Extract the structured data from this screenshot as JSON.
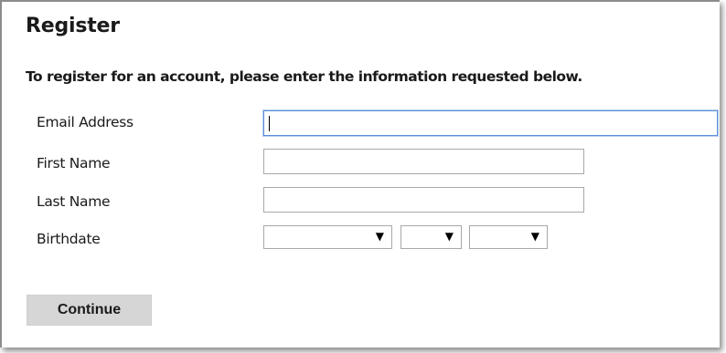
{
  "page": {
    "title": "Register",
    "intro": "To register for an account, please enter the information requested below."
  },
  "form": {
    "email": {
      "label": "Email Address",
      "value": ""
    },
    "first_name": {
      "label": "First Name",
      "value": ""
    },
    "last_name": {
      "label": "Last Name",
      "value": ""
    },
    "birthdate": {
      "label": "Birthdate",
      "month": {
        "selected": "",
        "arrow": "▼"
      },
      "day": {
        "selected": "",
        "arrow": "▼"
      },
      "year": {
        "selected": "",
        "arrow": "▼"
      }
    },
    "continue_label": "Continue"
  },
  "colors": {
    "focus_border": "#5b8dd6",
    "button_bg": "#d6d6d6"
  }
}
